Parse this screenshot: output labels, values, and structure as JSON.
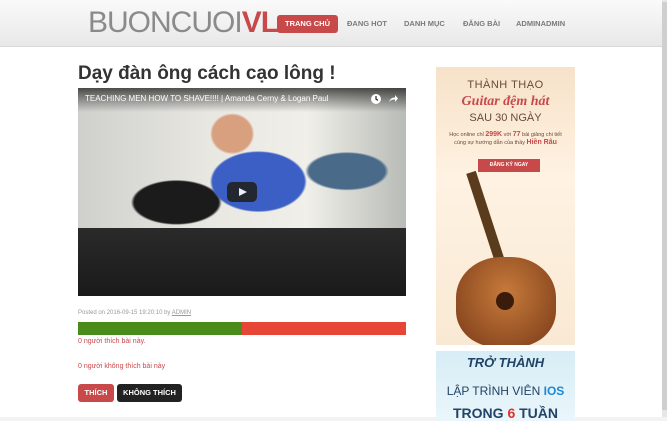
{
  "logo": {
    "part1": "BUONCUOI",
    "part2": "VL"
  },
  "nav": [
    {
      "label": "TRANG CHỦ",
      "active": true
    },
    {
      "label": "ĐANG HOT"
    },
    {
      "label": "DANH MỤC"
    },
    {
      "label": "ĐĂNG BÀI"
    },
    {
      "label": "ADMINADMIN"
    }
  ],
  "post": {
    "title": "Dạy đàn ông cách cạo lông !",
    "video": {
      "title": "TEACHING MEN HOW TO SHAVE!!!! | Amanda Cerny & Logan Paul"
    },
    "meta_prefix": "Posted on 2016-09-15 19:20:10 by",
    "author": "ADMIN",
    "like_ratio": 0.5,
    "likes_text": "0 người thích bài này.",
    "dislikes_text": "0 người không thích bài này",
    "like_button": "THÍCH",
    "dislike_button": "KHÔNG THÍCH"
  },
  "ads": {
    "guitar": {
      "line1": "THÀNH THẠO",
      "line2": "Guitar đệm hát",
      "line3": "SAU 30 NGÀY",
      "desc_a": "Học online chỉ ",
      "price": "299K",
      "desc_b": " với ",
      "count": "77",
      "desc_c": " bài giảng chi tiết cùng sự hướng dẫn của thầy ",
      "teacher": "Hiền Râu",
      "cta": "ĐĂNG KÝ NGAY"
    },
    "ios": {
      "line1": "TRỞ THÀNH",
      "line2a": "LẬP TRÌNH VIÊN ",
      "line2b": "IOS",
      "line3a": "TRONG ",
      "line3b": "6",
      "line3c": " TUẦN"
    }
  },
  "colors": {
    "accent": "#c8494a",
    "like": "#4a8c1c",
    "dislike": "#e74535"
  }
}
